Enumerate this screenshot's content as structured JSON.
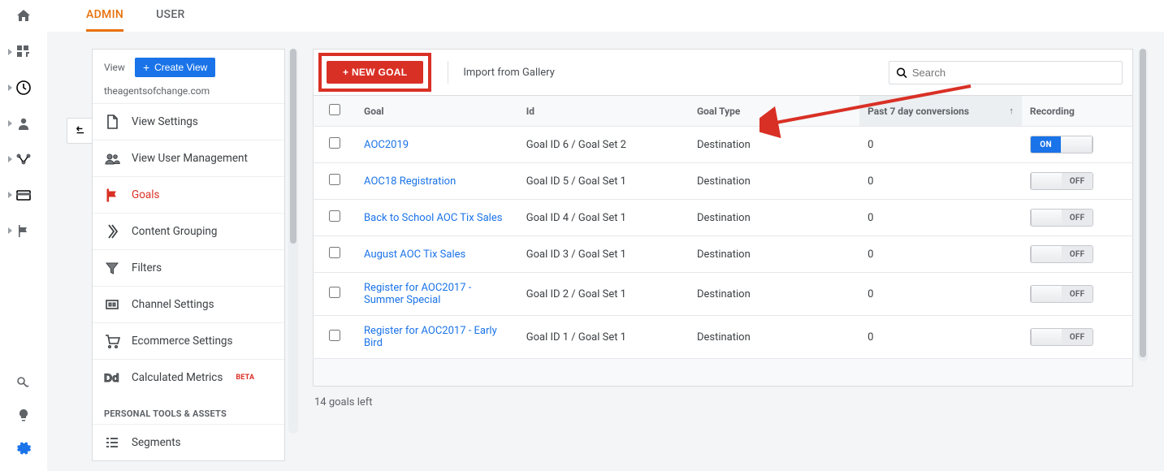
{
  "tabs": {
    "admin": "ADMIN",
    "user": "USER",
    "active": "admin"
  },
  "rail_icons": [
    "home",
    "dashboard",
    "clock",
    "person",
    "flow",
    "card",
    "flag"
  ],
  "rail_bottom": [
    "discover",
    "lightbulb",
    "gear"
  ],
  "view_panel": {
    "label": "View",
    "create_label": "Create View",
    "domain": "theagentsofchange.com",
    "items": [
      {
        "id": "view-settings",
        "label": "View Settings",
        "icon": "file"
      },
      {
        "id": "view-user-mgmt",
        "label": "View User Management",
        "icon": "group"
      },
      {
        "id": "goals",
        "label": "Goals",
        "icon": "flag",
        "active": true
      },
      {
        "id": "content-grouping",
        "label": "Content Grouping",
        "icon": "conversion"
      },
      {
        "id": "filters",
        "label": "Filters",
        "icon": "filter"
      },
      {
        "id": "channel-settings",
        "label": "Channel Settings",
        "icon": "channel"
      },
      {
        "id": "ecommerce",
        "label": "Ecommerce Settings",
        "icon": "cart"
      },
      {
        "id": "calc-metrics",
        "label": "Calculated Metrics",
        "icon": "dd",
        "beta": "BETA"
      }
    ],
    "section": "PERSONAL TOOLS & ASSETS",
    "items2": [
      {
        "id": "segments",
        "label": "Segments",
        "icon": "segments"
      }
    ]
  },
  "toolbar": {
    "new_goal": "+ NEW GOAL",
    "import": "Import from Gallery",
    "search_placeholder": "Search"
  },
  "table": {
    "columns": {
      "goal": "Goal",
      "id": "Id",
      "type": "Goal Type",
      "conv": "Past 7 day conversions",
      "rec": "Recording"
    },
    "rows": [
      {
        "goal": "AOC2019",
        "id": "Goal ID 6 / Goal Set 2",
        "type": "Destination",
        "conv": "0",
        "rec": "ON"
      },
      {
        "goal": "AOC18 Registration",
        "id": "Goal ID 5 / Goal Set 1",
        "type": "Destination",
        "conv": "0",
        "rec": "OFF"
      },
      {
        "goal": "Back to School AOC Tix Sales",
        "id": "Goal ID 4 / Goal Set 1",
        "type": "Destination",
        "conv": "0",
        "rec": "OFF"
      },
      {
        "goal": "August AOC Tix Sales",
        "id": "Goal ID 3 / Goal Set 1",
        "type": "Destination",
        "conv": "0",
        "rec": "OFF"
      },
      {
        "goal": "Register for AOC2017 - Summer Special",
        "id": "Goal ID 2 / Goal Set 1",
        "type": "Destination",
        "conv": "0",
        "rec": "OFF"
      },
      {
        "goal": "Register for AOC2017 - Early Bird",
        "id": "Goal ID 1 / Goal Set 1",
        "type": "Destination",
        "conv": "0",
        "rec": "OFF"
      }
    ],
    "goals_left": "14 goals left",
    "toggle_on": "ON",
    "toggle_off": "OFF"
  }
}
